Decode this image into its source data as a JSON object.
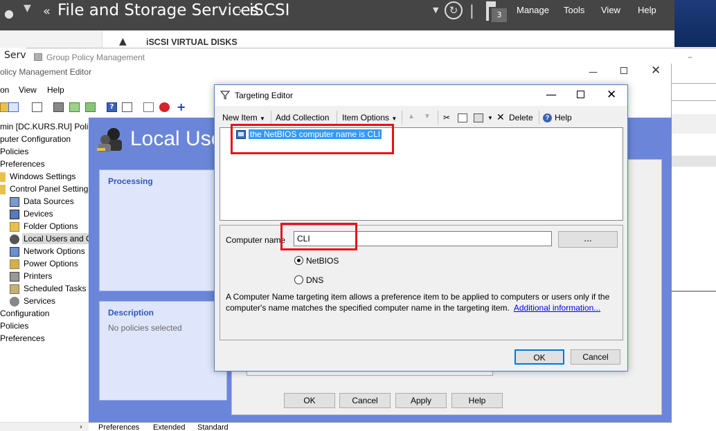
{
  "server_manager": {
    "breadcrumb_1": "File and Storage Services",
    "breadcrumb_2": "iSCSI",
    "notification_count": "3",
    "menu": [
      "Manage",
      "Tools",
      "View",
      "Help"
    ],
    "section_title": "iSCSI VIRTUAL DISKS",
    "left_label": "Serve"
  },
  "gpm_window": {
    "title": "Group Policy Management"
  },
  "gpme": {
    "title": "olicy Management Editor",
    "menu": [
      "on",
      "View",
      "Help"
    ],
    "tree": [
      "min [DC.KURS.RU] Policy",
      "puter Configuration",
      "Policies",
      "Preferences",
      "Windows Settings",
      "Control Panel Settings",
      "Data Sources",
      "Devices",
      "Folder Options",
      "Local Users and Groups",
      "Network Options",
      "Power Options",
      "Printers",
      "Scheduled Tasks",
      "Services",
      "Configuration",
      "Policies",
      "Preferences"
    ],
    "center_title": "Local Users and Groups",
    "processing_label": "Processing",
    "description_label": "Description",
    "description_text": "No policies selected",
    "buttons": [
      "OK",
      "Cancel",
      "Apply",
      "Help"
    ],
    "tabs": [
      "Preferences",
      "Extended",
      "Standard"
    ]
  },
  "targeting_editor": {
    "title": "Targeting Editor",
    "toolbar": {
      "new_item": "New Item",
      "add_collection": "Add Collection",
      "item_options": "Item Options",
      "delete": "Delete",
      "help": "Help"
    },
    "selected_item": "the NetBIOS computer name is CLI",
    "computer_name_label": "Computer name",
    "computer_name_value": "CLI",
    "browse_label": "...",
    "radio_netbios": "NetBIOS",
    "radio_dns": "DNS",
    "selected_radio": "NetBIOS",
    "help_text": "A Computer Name targeting item allows a preference item to be applied to computers or users only if the computer's name matches the specified computer name in the targeting item.",
    "help_link": "Additional information...",
    "ok_label": "OK",
    "cancel_label": "Cancel"
  },
  "colors": {
    "selection": "#3399ff",
    "highlight_red": "#e8101a",
    "pane_blue": "#6b86d9",
    "card_title_blue": "#2e57b8",
    "sm_bar": "#454545"
  }
}
